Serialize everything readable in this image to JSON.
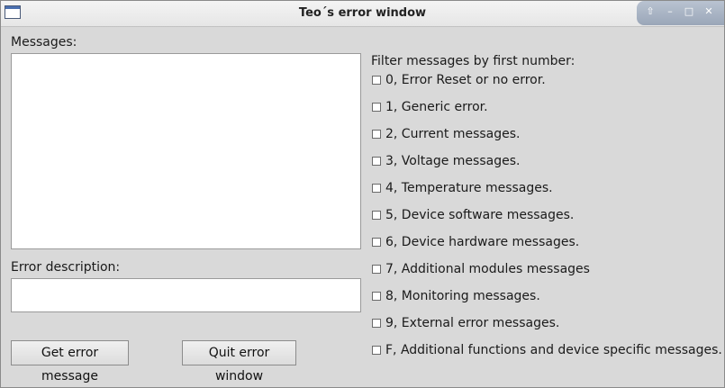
{
  "window": {
    "title": "Teo´s error window",
    "controls": [
      "⇧",
      "–",
      "□",
      "✕"
    ]
  },
  "messages": {
    "label": "Messages:",
    "value": ""
  },
  "error_description": {
    "label": "Error description:",
    "value": ""
  },
  "buttons": {
    "get_error": "Get error message",
    "quit": "Quit error window"
  },
  "filter": {
    "label": "Filter messages by first number:",
    "options": [
      {
        "label": "0, Error Reset or no error.",
        "checked": false
      },
      {
        "label": "1, Generic error.",
        "checked": false
      },
      {
        "label": "2, Current messages.",
        "checked": false
      },
      {
        "label": "3, Voltage messages.",
        "checked": false
      },
      {
        "label": "4, Temperature messages.",
        "checked": false
      },
      {
        "label": "5, Device software messages.",
        "checked": false
      },
      {
        "label": "6, Device hardware messages.",
        "checked": false
      },
      {
        "label": "7, Additional modules messages",
        "checked": false
      },
      {
        "label": "8, Monitoring messages.",
        "checked": false
      },
      {
        "label": "9, External error messages.",
        "checked": false
      },
      {
        "label": "F, Additional functions and device specific messages.",
        "checked": false
      }
    ]
  }
}
